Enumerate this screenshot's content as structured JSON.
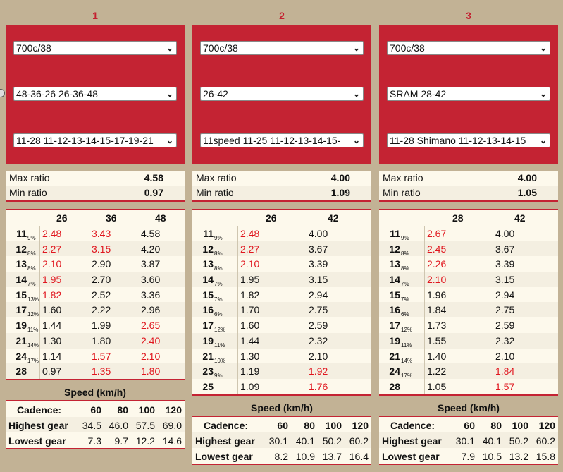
{
  "columns": [
    {
      "number": "1",
      "wheel": "700c/38",
      "chainrings": "48-36-26 26-36-48",
      "cassette": "11-28 11-12-13-14-15-17-19-21",
      "max_label": "Max ratio",
      "max_value": "4.58",
      "min_label": "Min ratio",
      "min_value": "0.97",
      "ring_headers": [
        "26",
        "36",
        "48"
      ],
      "rows": [
        {
          "cog": "11",
          "pct": "9%",
          "vals": [
            "2.48",
            "3.43",
            "4.58"
          ],
          "red": [
            true,
            true,
            false
          ]
        },
        {
          "cog": "12",
          "pct": "8%",
          "vals": [
            "2.27",
            "3.15",
            "4.20"
          ],
          "red": [
            true,
            true,
            false
          ]
        },
        {
          "cog": "13",
          "pct": "8%",
          "vals": [
            "2.10",
            "2.90",
            "3.87"
          ],
          "red": [
            true,
            false,
            false
          ]
        },
        {
          "cog": "14",
          "pct": "7%",
          "vals": [
            "1.95",
            "2.70",
            "3.60"
          ],
          "red": [
            true,
            false,
            false
          ]
        },
        {
          "cog": "15",
          "pct": "13%",
          "vals": [
            "1.82",
            "2.52",
            "3.36"
          ],
          "red": [
            true,
            false,
            false
          ]
        },
        {
          "cog": "17",
          "pct": "12%",
          "vals": [
            "1.60",
            "2.22",
            "2.96"
          ],
          "red": [
            false,
            false,
            false
          ]
        },
        {
          "cog": "19",
          "pct": "11%",
          "vals": [
            "1.44",
            "1.99",
            "2.65"
          ],
          "red": [
            false,
            false,
            true
          ]
        },
        {
          "cog": "21",
          "pct": "14%",
          "vals": [
            "1.30",
            "1.80",
            "2.40"
          ],
          "red": [
            false,
            false,
            true
          ]
        },
        {
          "cog": "24",
          "pct": "17%",
          "vals": [
            "1.14",
            "1.57",
            "2.10"
          ],
          "red": [
            false,
            true,
            true
          ]
        },
        {
          "cog": "28",
          "pct": "",
          "vals": [
            "0.97",
            "1.35",
            "1.80"
          ],
          "red": [
            false,
            true,
            true
          ]
        }
      ],
      "speed_title": "Speed (km/h)",
      "cadence_label": "Cadence:",
      "cadences": [
        "60",
        "80",
        "100",
        "120"
      ],
      "highest_label": "Highest gear",
      "highest": [
        "34.5",
        "46.0",
        "57.5",
        "69.0"
      ],
      "lowest_label": "Lowest gear",
      "lowest": [
        "7.3",
        "9.7",
        "12.2",
        "14.6"
      ]
    },
    {
      "number": "2",
      "wheel": "700c/38",
      "chainrings": "26-42",
      "cassette": "11speed 11-25 11-12-13-14-15-",
      "max_label": "Max ratio",
      "max_value": "4.00",
      "min_label": "Min ratio",
      "min_value": "1.09",
      "ring_headers": [
        "26",
        "42"
      ],
      "rows": [
        {
          "cog": "11",
          "pct": "9%",
          "vals": [
            "2.48",
            "4.00"
          ],
          "red": [
            true,
            false
          ]
        },
        {
          "cog": "12",
          "pct": "8%",
          "vals": [
            "2.27",
            "3.67"
          ],
          "red": [
            true,
            false
          ]
        },
        {
          "cog": "13",
          "pct": "8%",
          "vals": [
            "2.10",
            "3.39"
          ],
          "red": [
            true,
            false
          ]
        },
        {
          "cog": "14",
          "pct": "7%",
          "vals": [
            "1.95",
            "3.15"
          ],
          "red": [
            false,
            false
          ]
        },
        {
          "cog": "15",
          "pct": "7%",
          "vals": [
            "1.82",
            "2.94"
          ],
          "red": [
            false,
            false
          ]
        },
        {
          "cog": "16",
          "pct": "6%",
          "vals": [
            "1.70",
            "2.75"
          ],
          "red": [
            false,
            false
          ]
        },
        {
          "cog": "17",
          "pct": "12%",
          "vals": [
            "1.60",
            "2.59"
          ],
          "red": [
            false,
            false
          ]
        },
        {
          "cog": "19",
          "pct": "11%",
          "vals": [
            "1.44",
            "2.32"
          ],
          "red": [
            false,
            false
          ]
        },
        {
          "cog": "21",
          "pct": "10%",
          "vals": [
            "1.30",
            "2.10"
          ],
          "red": [
            false,
            false
          ]
        },
        {
          "cog": "23",
          "pct": "9%",
          "vals": [
            "1.19",
            "1.92"
          ],
          "red": [
            false,
            true
          ]
        },
        {
          "cog": "25",
          "pct": "",
          "vals": [
            "1.09",
            "1.76"
          ],
          "red": [
            false,
            true
          ]
        }
      ],
      "speed_title": "Speed (km/h)",
      "cadence_label": "Cadence:",
      "cadences": [
        "60",
        "80",
        "100",
        "120"
      ],
      "highest_label": "Highest gear",
      "highest": [
        "30.1",
        "40.1",
        "50.2",
        "60.2"
      ],
      "lowest_label": "Lowest gear",
      "lowest": [
        "8.2",
        "10.9",
        "13.7",
        "16.4"
      ]
    },
    {
      "number": "3",
      "wheel": "700c/38",
      "chainrings": "SRAM 28-42",
      "cassette": "11-28 Shimano 11-12-13-14-15",
      "max_label": "Max ratio",
      "max_value": "4.00",
      "min_label": "Min ratio",
      "min_value": "1.05",
      "ring_headers": [
        "28",
        "42"
      ],
      "rows": [
        {
          "cog": "11",
          "pct": "9%",
          "vals": [
            "2.67",
            "4.00"
          ],
          "red": [
            true,
            false
          ]
        },
        {
          "cog": "12",
          "pct": "8%",
          "vals": [
            "2.45",
            "3.67"
          ],
          "red": [
            true,
            false
          ]
        },
        {
          "cog": "13",
          "pct": "8%",
          "vals": [
            "2.26",
            "3.39"
          ],
          "red": [
            true,
            false
          ]
        },
        {
          "cog": "14",
          "pct": "7%",
          "vals": [
            "2.10",
            "3.15"
          ],
          "red": [
            true,
            false
          ]
        },
        {
          "cog": "15",
          "pct": "7%",
          "vals": [
            "1.96",
            "2.94"
          ],
          "red": [
            false,
            false
          ]
        },
        {
          "cog": "16",
          "pct": "6%",
          "vals": [
            "1.84",
            "2.75"
          ],
          "red": [
            false,
            false
          ]
        },
        {
          "cog": "17",
          "pct": "12%",
          "vals": [
            "1.73",
            "2.59"
          ],
          "red": [
            false,
            false
          ]
        },
        {
          "cog": "19",
          "pct": "11%",
          "vals": [
            "1.55",
            "2.32"
          ],
          "red": [
            false,
            false
          ]
        },
        {
          "cog": "21",
          "pct": "14%",
          "vals": [
            "1.40",
            "2.10"
          ],
          "red": [
            false,
            false
          ]
        },
        {
          "cog": "24",
          "pct": "17%",
          "vals": [
            "1.22",
            "1.84"
          ],
          "red": [
            false,
            true
          ]
        },
        {
          "cog": "28",
          "pct": "",
          "vals": [
            "1.05",
            "1.57"
          ],
          "red": [
            false,
            true
          ]
        }
      ],
      "speed_title": "Speed (km/h)",
      "cadence_label": "Cadence:",
      "cadences": [
        "60",
        "80",
        "100",
        "120"
      ],
      "highest_label": "Highest gear",
      "highest": [
        "30.1",
        "40.1",
        "50.2",
        "60.2"
      ],
      "lowest_label": "Lowest gear",
      "lowest": [
        "7.9",
        "10.5",
        "13.2",
        "15.8"
      ]
    }
  ]
}
